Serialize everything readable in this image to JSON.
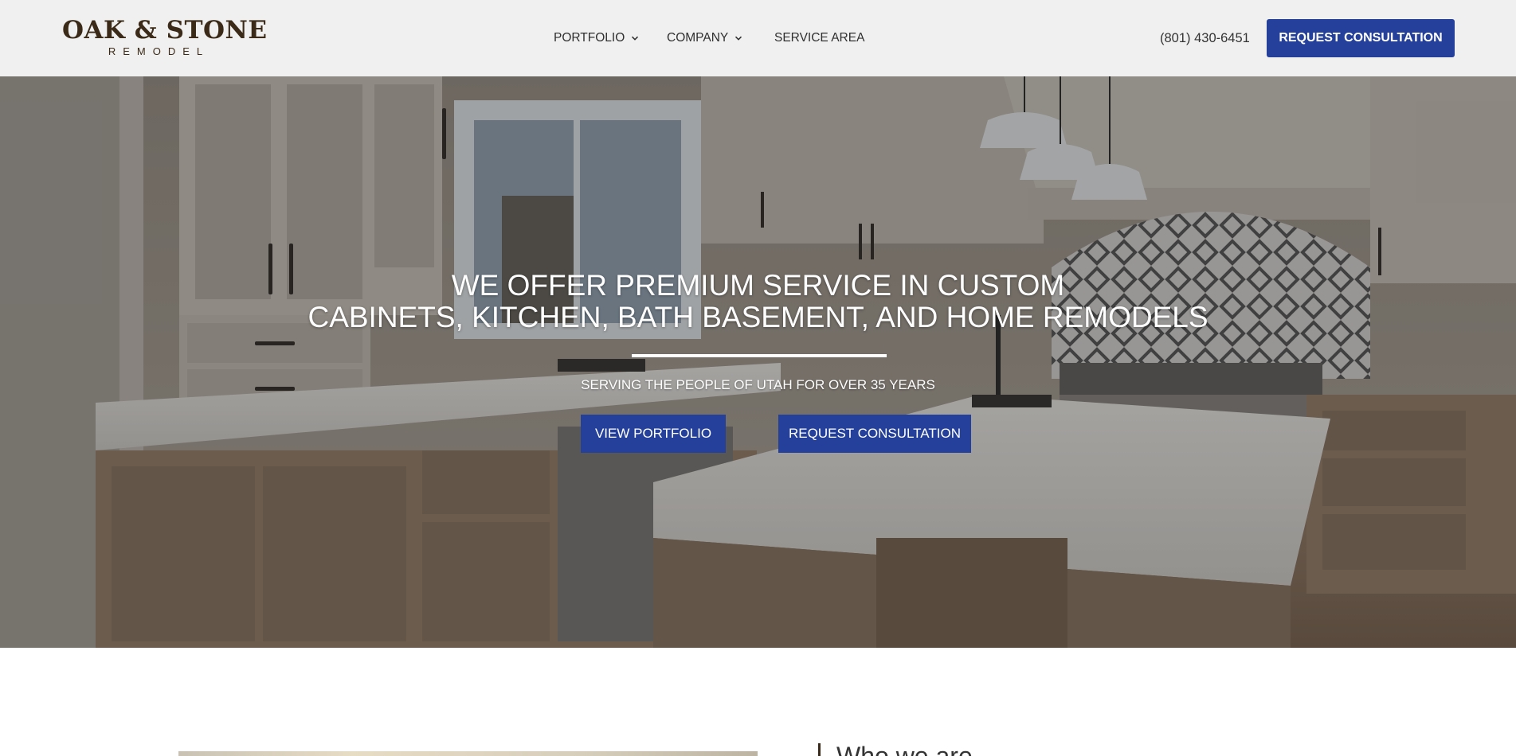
{
  "header": {
    "logo": {
      "main": "OAK & STONE",
      "sub": "REMODEL"
    },
    "nav": [
      {
        "label": "PORTFOLIO",
        "has_dropdown": true
      },
      {
        "label": "COMPANY",
        "has_dropdown": true
      },
      {
        "label": "SERVICE AREA",
        "has_dropdown": false
      }
    ],
    "phone": "(801) 430-6451",
    "cta_label": "REQUEST CONSULTATION"
  },
  "hero": {
    "title_line1": "WE OFFER PREMIUM SERVICE IN CUSTOM",
    "title_line2": "CABINETS, KITCHEN, BATH BASEMENT, AND HOME REMODELS",
    "subtitle": "SERVING THE PEOPLE OF UTAH FOR OVER 35 YEARS",
    "button_primary": "VIEW PORTFOLIO",
    "button_secondary": "REQUEST CONSULTATION"
  },
  "about": {
    "heading": "Who we are"
  },
  "colors": {
    "accent": "#25409a",
    "header_bg": "#f0f0f0",
    "logo": "#3b2a17"
  }
}
